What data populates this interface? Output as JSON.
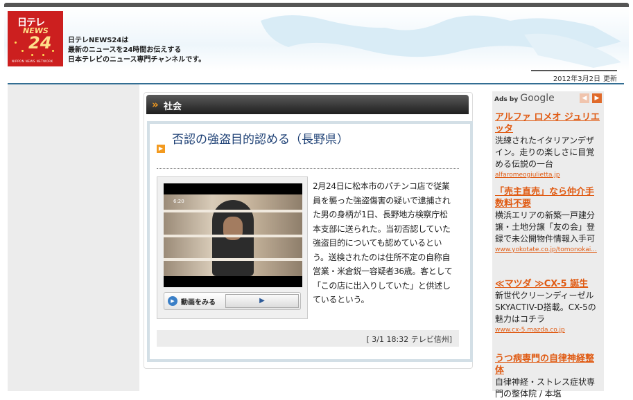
{
  "header": {
    "logo": {
      "line1": "日テレ",
      "line2": "NEWS",
      "line3": "24",
      "tagline": "NIPPON NEWS NETWORK"
    },
    "tagline_lines": [
      "日テレNEWS24は",
      "最新のニュースを24時間お伝えする",
      "日本テレビのニュース専門チャンネルです。"
    ],
    "date": "2012年3月2日",
    "date_suffix": "更新"
  },
  "category": {
    "label": "社会",
    "arrow": "»"
  },
  "article": {
    "headline": "否認の強盗目的認める（長野県）",
    "body": "2月24日に松本市のパチンコ店で従業員を襲った強盗傷害の疑いで逮捕された男の身柄が1日、長野地方検察庁松本支部に送られた。当初否認していた強盗目的についても認めているという。送検されたのは住所不定の自称自営業・米倉鋭一容疑者36歳。客として「この店に出入りしていた」と供述しているという。",
    "video": {
      "timestamp": "6:20",
      "button_label": "動画をみる",
      "play_glyph": "▶"
    },
    "credit": "[ 3/1 18:32 テレビ信州]"
  },
  "ads": {
    "header_prefix": "Ads by",
    "header_brand": "Google",
    "items": [
      {
        "title": "アルファ ロメオ ジュリエッタ",
        "desc": "洗練されたイタリアンデザイン。走りの楽しさに目覚める伝説の一台",
        "url": "alfaromeogiulietta.jp"
      },
      {
        "title": "「売主直売」なら仲介手数料不要",
        "desc": "横浜エリアの新築一戸建分譲・土地分譲「友の会」登録で未公開物件情報入手可",
        "url": "www.yokotate.co.jp/tomonokai..."
      },
      {
        "title": "≪マツダ ≫CX-5 誕生",
        "desc": "新世代クリーンディーゼルSKYACTIV-D搭載。CX-5の魅力はコチラ",
        "url": "www.cx-5.mazda.co.jp"
      },
      {
        "title": "うつ病専門の自律神経整体",
        "desc": "自律神経・ストレス症状専門の整体院 / 本塩",
        "url": ""
      }
    ]
  },
  "colors": {
    "accent": "#f39a1f",
    "headline": "#1c3f74",
    "ad_link": "#e05a12",
    "rule": "#336e93"
  }
}
